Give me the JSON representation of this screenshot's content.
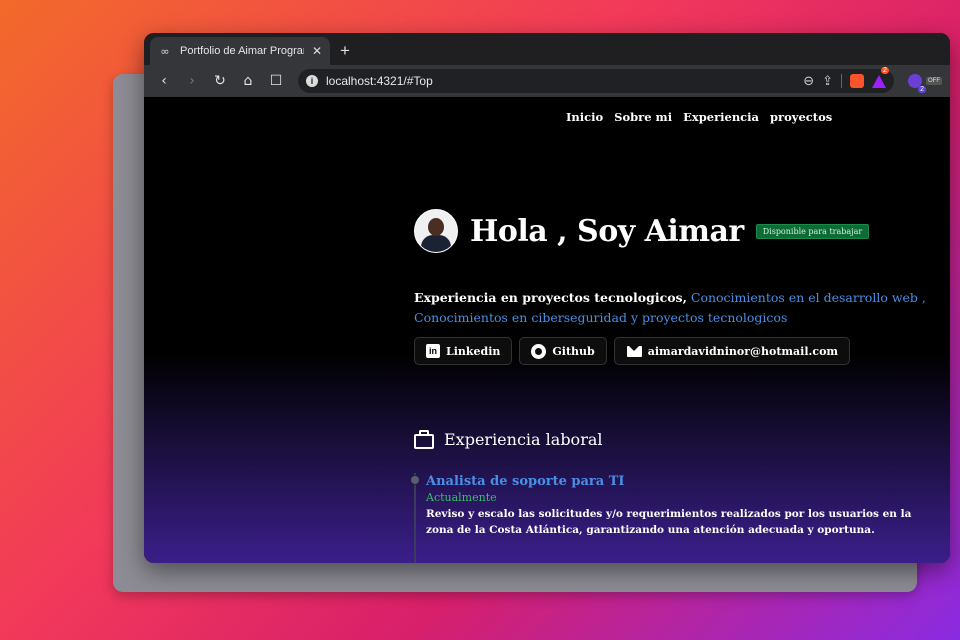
{
  "browser": {
    "tab": {
      "favicon": "∞",
      "title": "Portfolio de Aimar Programador",
      "close": "✕"
    },
    "new_tab": "+",
    "toolbar": {
      "back": "‹",
      "forward": "›",
      "reload": "↻",
      "home": "⌂",
      "bookmark": "☐",
      "info": "i",
      "url": "localhost:4321/#Top",
      "zoom_icon": "⊖",
      "share_icon": "⇪",
      "rewards_count": "2",
      "ext_badge": "2",
      "ext_off": "OFF"
    }
  },
  "site": {
    "nav": [
      "Inicio",
      "Sobre mi",
      "Experiencia",
      "proyectos"
    ],
    "hero": {
      "title": "Hola , Soy Aimar",
      "badge": "Disponible para trabajar"
    },
    "intro": {
      "part1": "Experiencia en proyectos tecnologicos,",
      "part2": " Conocimientos en el desarrollo web , Conocimientos en ciberseguridad y proyectos tecnologicos"
    },
    "contacts": {
      "linkedin": "Linkedin",
      "github": "Github",
      "email": "aimardavidninor@hotmail.com",
      "linkedin_icon": "in"
    },
    "experience": {
      "heading": "Experiencia laboral",
      "jobs": [
        {
          "title": "Analista de soporte para TI",
          "date": "Actualmente",
          "description": "Reviso y escalo las solicitudes y/o requerimientos realizados por los usuarios en la zona de la Costa Atlántica, garantizando una atención adecuada y oportuna."
        }
      ]
    }
  }
}
